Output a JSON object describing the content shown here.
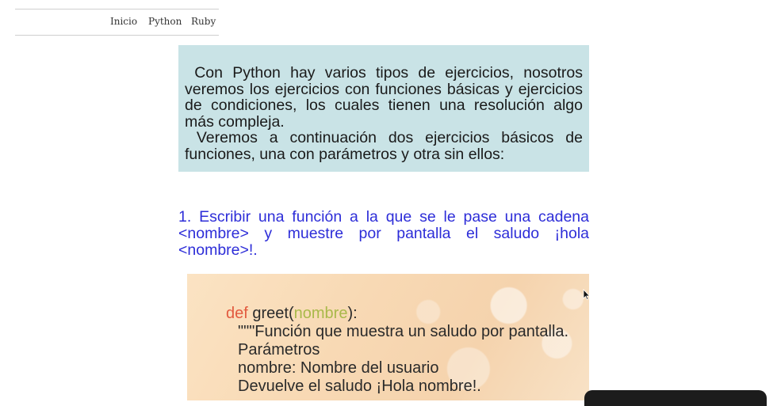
{
  "nav": {
    "items": [
      {
        "label": "Inicio"
      },
      {
        "label": "Python"
      },
      {
        "label": "Ruby"
      }
    ]
  },
  "intro": {
    "paragraph1": " Con Python hay varios tipos de ejercicios, nosotros veremos los ejercicios con funciones básicas y ejercicios de condiciones, los cuales tienen una resolución algo más compleja.",
    "paragraph2": " Veremos a continuación dos ejercicios básicos de funciones, una con parámetros y otra sin ellos:"
  },
  "exercise": {
    "text": "1. Escribir una función a la que se le pase una cadena <nombre> y muestre por pantalla el saludo ¡hola <nombre>!."
  },
  "code": {
    "keyword": "def",
    "func_name": " greet(",
    "param": "nombre",
    "close": "):",
    "line2": "\"\"\"Función que muestra un saludo por pantalla.",
    "line3": "Parámetros",
    "line4": "nombre: Nombre del usuario",
    "line5": "Devuelve el saludo ¡Hola nombre!."
  },
  "colors": {
    "intro_bg": "#c9e3e6",
    "exercise_text": "#2d2dd8",
    "keyword": "#e25a3f",
    "param": "#a9b94a"
  }
}
